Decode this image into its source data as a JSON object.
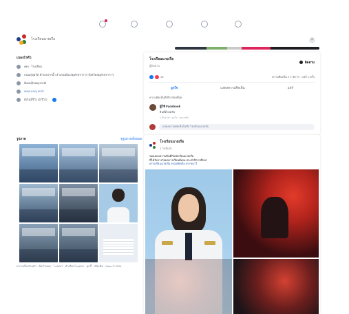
{
  "top_icons": [
    "notification-icon",
    "messenger-icon",
    "video-icon",
    "marketplace-icon",
    "groups-icon"
  ],
  "colors": {
    "accent": "#1877f2",
    "progress": [
      "#2f3540",
      "#7fb069",
      "#c9c9c9",
      "#e0245e",
      "#1c1e21"
    ]
  },
  "page": {
    "name": "โรงเรียนนายเรือ"
  },
  "intro": {
    "title": "แนะนำตัว",
    "rows": [
      {
        "icon": "info-icon",
        "text": "เพจ · โรงเรียน"
      },
      {
        "icon": "location-icon",
        "text": "ถนนสุขุมวิท ตำบลปากน้ำ อำเภอเมืองสมุทรปราการ จังหวัดสมุทรปราการ"
      },
      {
        "icon": "email-icon",
        "text": "อีเมล@navy.mi.th"
      },
      {
        "icon": "link-icon",
        "text": "www.navy.mi.th",
        "link": true
      },
      {
        "icon": "star-icon",
        "text": "ยังไม่มีรีวิว (0 รีวิว)"
      }
    ]
  },
  "photos": {
    "title": "รูปภาพ",
    "see_all": "ดูรูปภาพทั้งหมด"
  },
  "footer": "ความเป็นส่วนตัว · ข้อกำหนด · โฆษณา · ตัวเลือกโฆษณา · คุกกี้ · เพิ่มเติม · Meta © 2024",
  "post_top": {
    "name": "โรงเรียนนายเรือ",
    "sub": "ผู้ติดตาม",
    "follow_label": "ติดตาม",
    "stats_left": "15",
    "stats_right": "ความคิดเห็น 2 รายการ · แชร์ 1 ครั้ง",
    "actions": [
      "ถูกใจ",
      "แสดงความคิดเห็น",
      "แชร์"
    ],
    "relevant": "ความคิดเห็นที่เกี่ยวข้องที่สุด",
    "comment": {
      "name": "ผู้ใช้ Facebook",
      "text": "ยินดีด้วยครับ",
      "meta": "1 สัปดาห์ · ถูกใจ · ตอบกลับ"
    },
    "input_placeholder": "แสดงความคิดเห็นในชื่อ โรงเรียนนายเรือ"
  },
  "post2": {
    "name": "โรงเรียนนายเรือ",
    "time": "3 วันที่แล้ว",
    "line1": "ขอแสดงความยินดีกับนักเรียนนายเรือ",
    "line2": "ที่ได้รับรางวัลผลการเรียนดีเด่น ประจำปีการศึกษา",
    "tags": "#โรงเรียนนายเรือ #กองทัพเรือ #ราชนาวี"
  }
}
